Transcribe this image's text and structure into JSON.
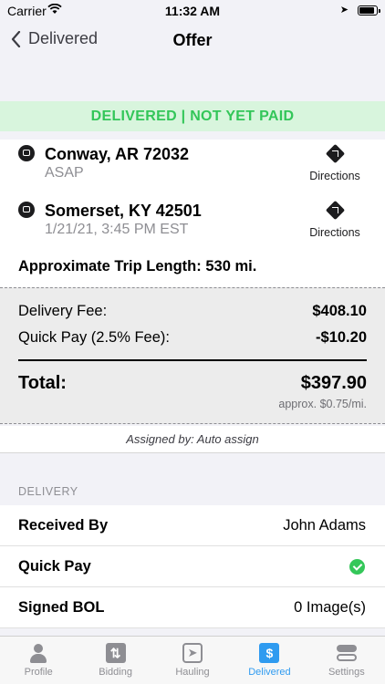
{
  "status_bar": {
    "carrier": "Carrier",
    "time": "11:32 AM"
  },
  "nav": {
    "back_label": "Delivered",
    "title": "Offer"
  },
  "banner": {
    "text": "DELIVERED | NOT YET PAID",
    "color": "#33c659",
    "background": "#d8f5dd"
  },
  "stops": [
    {
      "city": "Conway, AR 72032",
      "time": "ASAP",
      "directions_label": "Directions"
    },
    {
      "city": "Somerset, KY 42501",
      "time": "1/21/21, 3:45 PM EST",
      "directions_label": "Directions"
    }
  ],
  "trip_length": "Approximate Trip Length: 530 mi.",
  "fees": {
    "delivery_fee_label": "Delivery Fee:",
    "delivery_fee_value": "$408.10",
    "quick_pay_label": "Quick Pay (2.5% Fee):",
    "quick_pay_value": "-$10.20",
    "total_label": "Total:",
    "total_value": "$397.90",
    "per_mile": "approx. $0.75/mi."
  },
  "assigned_by": "Assigned by: Auto assign",
  "delivery_section": {
    "header": "DELIVERY",
    "items": [
      {
        "label": "Received By",
        "value": "John Adams"
      },
      {
        "label": "Quick Pay",
        "value_icon": "checkmark-circle-icon"
      },
      {
        "label": "Signed BOL",
        "value": "0 Image(s)"
      }
    ]
  },
  "tabs": [
    {
      "label": "Profile",
      "icon": "person-icon"
    },
    {
      "label": "Bidding",
      "icon": "bidding-icon"
    },
    {
      "label": "Hauling",
      "icon": "hauling-icon"
    },
    {
      "label": "Delivered",
      "icon": "dollar-icon",
      "active": true
    },
    {
      "label": "Settings",
      "icon": "toggles-icon"
    }
  ],
  "colors": {
    "accent": "#2f9bf0",
    "success": "#34c759"
  }
}
